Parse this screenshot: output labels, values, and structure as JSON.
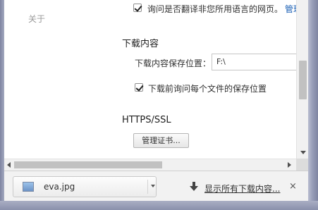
{
  "sidebar": {
    "about": "关于"
  },
  "translate": {
    "checked": true,
    "label": "询问是否翻译非您所用语言的网页。",
    "link": "管理"
  },
  "downloads": {
    "heading": "下载内容",
    "location_label": "下载内容保存位置：",
    "location_value": "F:\\",
    "ask_checked": true,
    "ask_label": "下载前询问每个文件的保存位置"
  },
  "https": {
    "heading": "HTTPS/SSL",
    "manage_button": "管理证书..."
  },
  "download_bar": {
    "file_name": "eva.jpg",
    "show_all": "显示所有下载内容...",
    "close": "×",
    "icons": {
      "file": "image-file-icon",
      "arrow": "download-arrow-icon"
    }
  }
}
